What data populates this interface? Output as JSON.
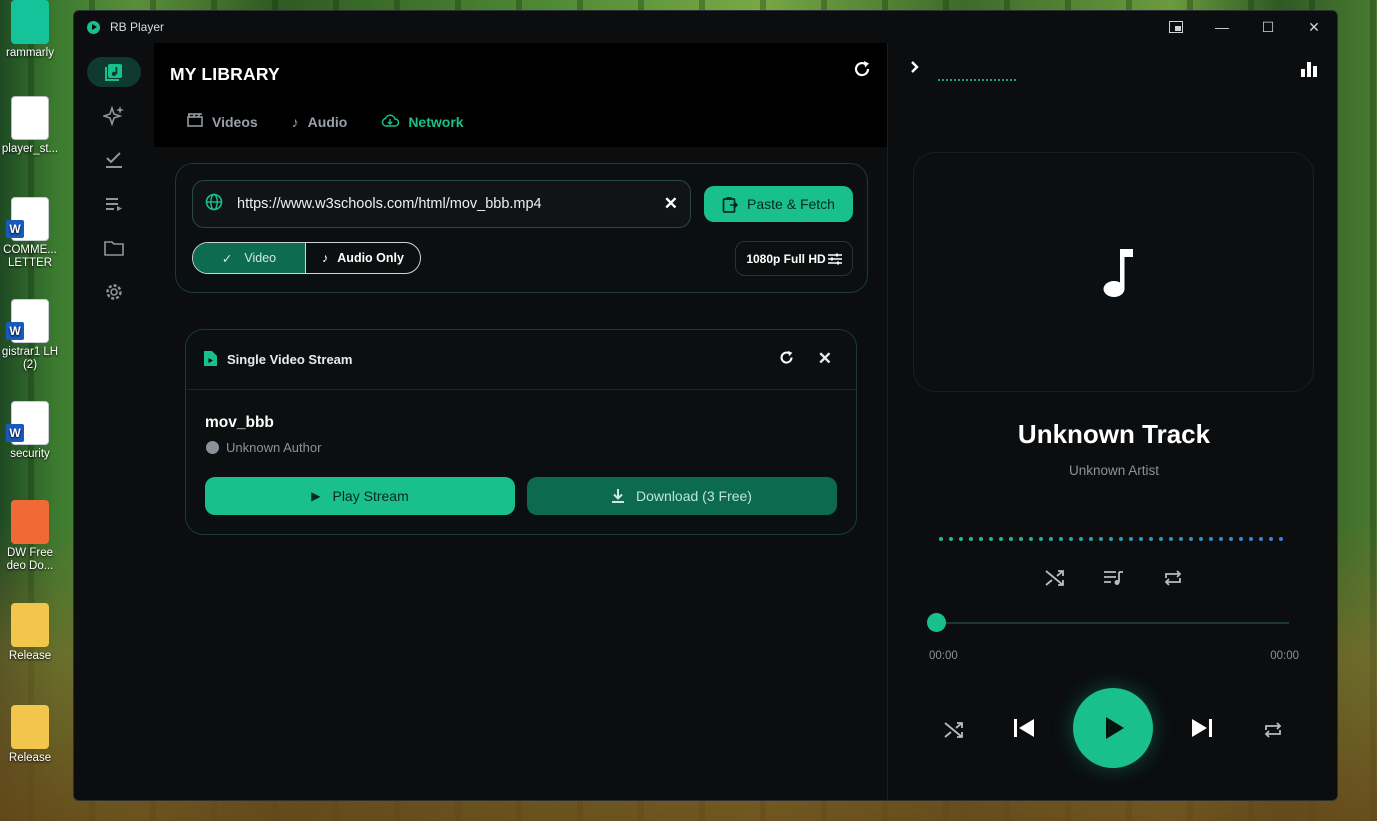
{
  "desktop": {
    "icons": [
      {
        "label": "rammarly"
      },
      {
        "label": "player_st..."
      },
      {
        "label": "COMME... LETTER"
      },
      {
        "label": "gistrar1 LH (2)"
      },
      {
        "label": "security"
      },
      {
        "label": "DW Free deo Do..."
      },
      {
        "label": "Release"
      },
      {
        "label": "Release"
      }
    ]
  },
  "window": {
    "title": "RB Player",
    "controls": {
      "pip": "pip-icon",
      "minimize": "—",
      "maximize": "☐",
      "close": "✕"
    }
  },
  "rail": {
    "items": [
      {
        "name": "library",
        "icon": "library-icon",
        "active": true
      },
      {
        "name": "ai",
        "icon": "sparkle-icon"
      },
      {
        "name": "tasks",
        "icon": "checklist-icon"
      },
      {
        "name": "playlist",
        "icon": "queue-icon"
      },
      {
        "name": "folder",
        "icon": "folder-icon"
      },
      {
        "name": "settings",
        "icon": "gear-icon"
      }
    ]
  },
  "library": {
    "title": "MY LIBRARY",
    "tabs": [
      {
        "label": "Videos"
      },
      {
        "label": "Audio"
      },
      {
        "label": "Network",
        "active": true
      }
    ]
  },
  "fetch": {
    "url": "https://www.w3schools.com/html/mov_bbb.mp4",
    "paste_label": "Paste & Fetch",
    "mode_video": "Video",
    "mode_audio": "Audio Only",
    "quality": "1080p Full HD"
  },
  "stream": {
    "header": "Single Video Stream",
    "title": "mov_bbb",
    "author": "Unknown Author",
    "play_label": "Play Stream",
    "download_label": "Download (3 Free)"
  },
  "player": {
    "track": "Unknown Track",
    "artist": "Unknown Artist",
    "time_current": "00:00",
    "time_total": "00:00",
    "progress": 0
  },
  "colors": {
    "accent": "#19c08a",
    "accent_dark": "#0c6a4e",
    "bg": "#0b0d0f",
    "wave_end": "#3b7fd6"
  }
}
